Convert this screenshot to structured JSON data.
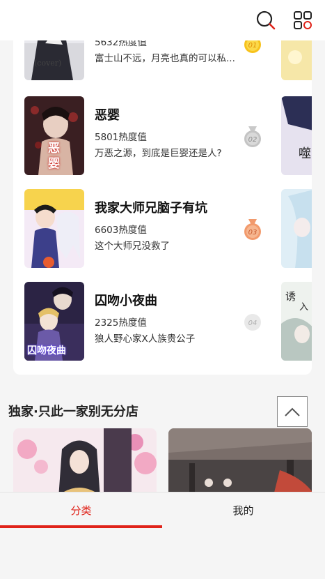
{
  "ranking": [
    {
      "rank_label": "01",
      "title": "",
      "heat": "5632热度值",
      "desc": "富士山不远，月亮也真的可以私...",
      "cover_text": "",
      "badge_color": "#f5b400"
    },
    {
      "rank_label": "02",
      "title": "恶婴",
      "heat": "5801热度值",
      "desc": "万恶之源，到底是巨婴还是人?",
      "cover_text": "恶婴",
      "badge_color": "#b8b8b8"
    },
    {
      "rank_label": "03",
      "title": "我家大师兄脑子有坑",
      "heat": "6603热度值",
      "desc": "这个大师兄没救了",
      "cover_text": "",
      "badge_color": "#ee8a5e"
    },
    {
      "rank_label": "04",
      "title": "囚吻小夜曲",
      "heat": "2325热度值",
      "desc": "狼人野心家X人族贵公子",
      "cover_text": "囚吻夜曲",
      "badge_color": "#d0d0d0"
    }
  ],
  "section": {
    "title": "独家·只此一家别无分店"
  },
  "bottom_nav": {
    "tabs": [
      {
        "label": "分类",
        "active": true
      },
      {
        "label": "我的",
        "active": false
      }
    ]
  },
  "colors": {
    "accent": "#e0231a",
    "background": "#f5f5f5"
  }
}
